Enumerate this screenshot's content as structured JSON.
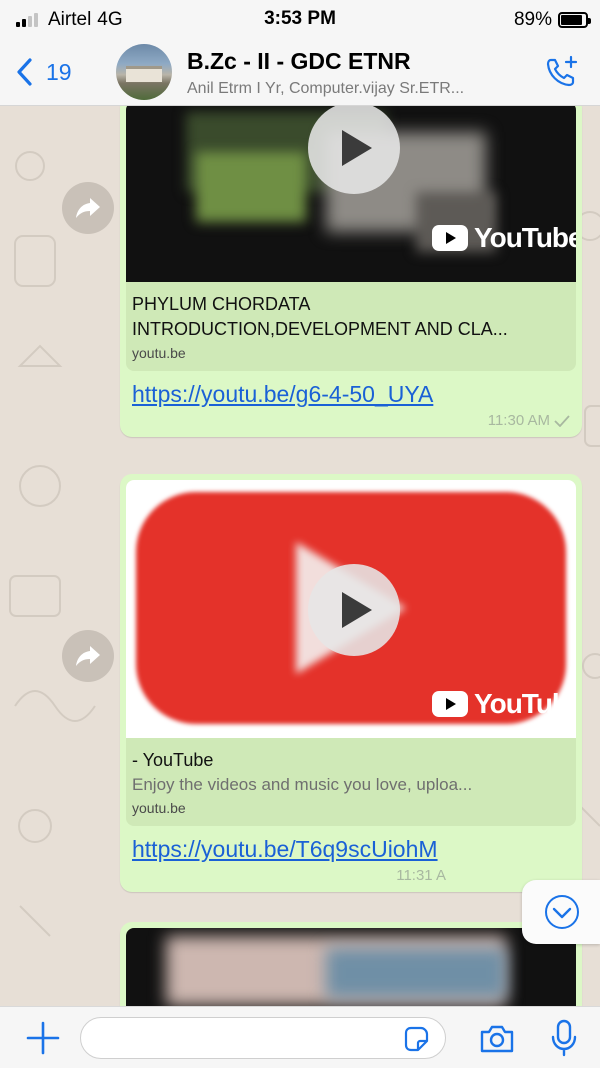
{
  "status_bar": {
    "carrier": "Airtel",
    "network": "4G",
    "time": "3:53 PM",
    "battery_percent": "89%",
    "battery_level": 0.89
  },
  "header": {
    "back_count": "19",
    "title": "B.Zc - II - GDC ETNR",
    "subtitle": "Anil Etrm I Yr, Computer.vijay Sr.ETR...",
    "back_icon": "chevron-left-icon",
    "call_icon": "add-call-icon"
  },
  "messages": [
    {
      "preview_title": "PHYLUM CHORDATA INTRODUCTION,DEVELOPMENT AND CLA...",
      "preview_domain": "youtu.be",
      "thumbnail_brand": "YouTube",
      "link": "https://youtu.be/g6-4-50_UYA",
      "time": "11:30 AM"
    },
    {
      "preview_title": "- YouTube",
      "preview_desc": "Enjoy the videos and music you love, uploa...",
      "preview_domain": "youtu.be",
      "thumbnail_brand": "YouTube",
      "link": "https://youtu.be/T6q9scUiohM",
      "time": "11:31 A"
    }
  ],
  "composer": {
    "placeholder": "",
    "icons": [
      "plus-icon",
      "sticker-icon",
      "camera-icon",
      "microphone-icon"
    ]
  },
  "colors": {
    "accent": "#1a73e8",
    "bubble": "#dcf8c6",
    "link": "#1a61d6"
  }
}
